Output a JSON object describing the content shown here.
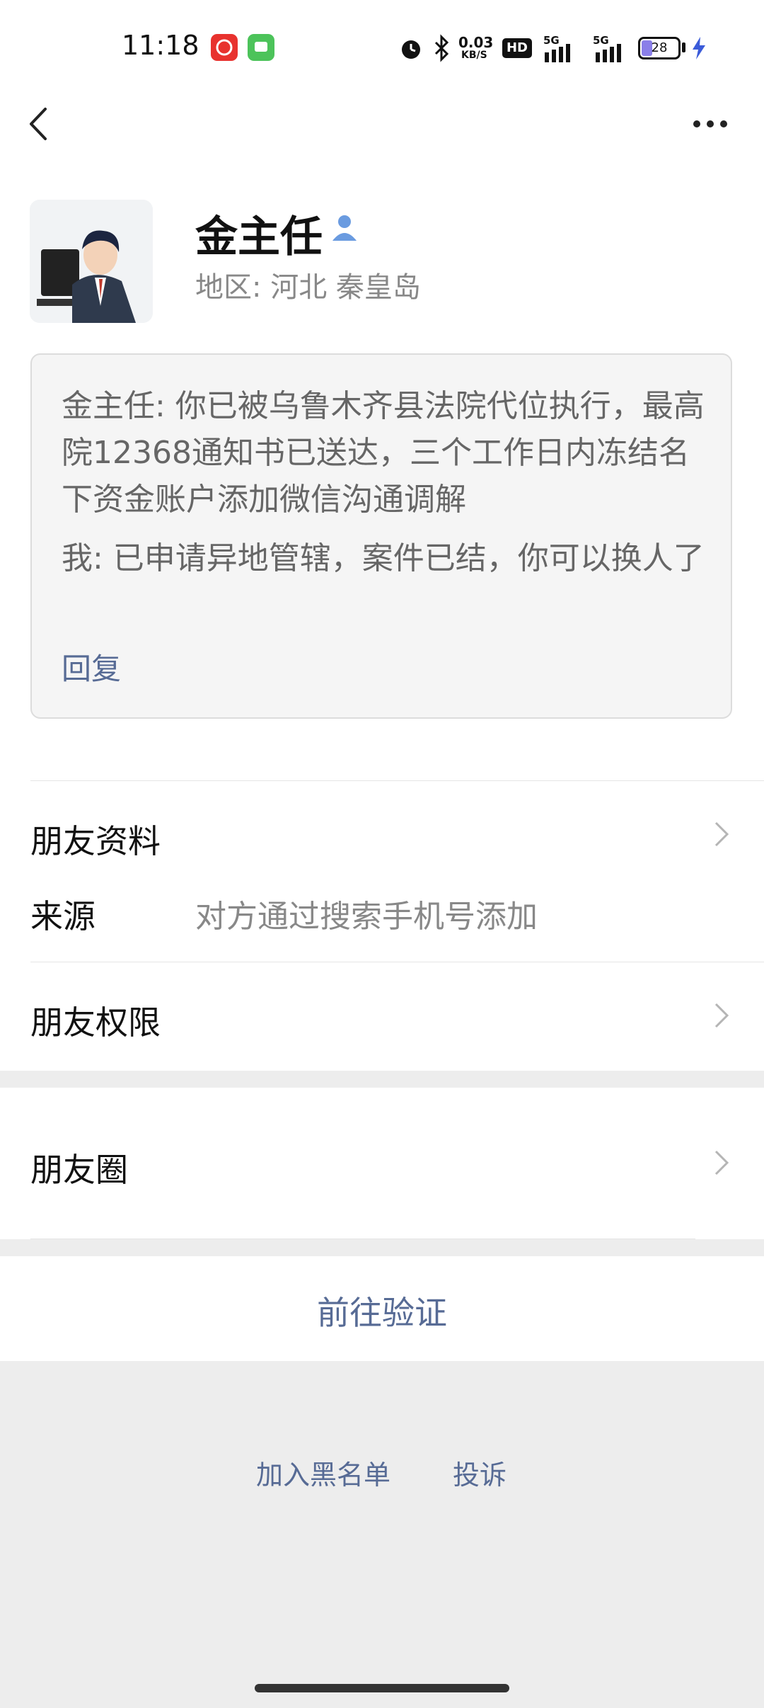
{
  "status_bar": {
    "time": "11:18",
    "network_speed_top": "0.03",
    "network_speed_unit": "KB/S",
    "hd_label": "HD",
    "sim1": "5G",
    "sim2": "5G",
    "battery": "28",
    "icons": [
      "app-red-icon",
      "app-green-icon",
      "alarm-icon",
      "bluetooth-icon",
      "hd-icon",
      "signal-icon",
      "signal-icon",
      "battery-icon",
      "charging-icon"
    ],
    "colors": {
      "app_red": "#e8322e",
      "app_green": "#4cc35a",
      "charging": "#3b5bd9",
      "battery_fill": "#8a7fe8"
    }
  },
  "header": {
    "back_icon": "chevron-left-icon",
    "more_icon": "more-dots-icon"
  },
  "profile": {
    "name": "金主任",
    "name_badge_icon": "person-icon",
    "region": "地区:  河北  秦皇岛",
    "avatar": "avatar-image"
  },
  "message_card": {
    "line1": "金主任: 你已被乌鲁木齐县法院代位执行，最高院12368通知书已送达，三个工作日内冻结名下资金账户添加微信沟通调解",
    "line2": "我: 已申请异地管辖，案件已结，你可以换人了",
    "reply": "回复"
  },
  "rows": {
    "friend_info": "朋友资料",
    "source_label": "来源",
    "source_value": "对方通过搜索手机号添加",
    "friend_permissions": "朋友权限",
    "moments": "朋友圈"
  },
  "actions": {
    "verify": "前往验证",
    "blacklist": "加入黑名单",
    "report": "投诉"
  },
  "colors": {
    "link": "#576b95",
    "background": "#ededed"
  }
}
